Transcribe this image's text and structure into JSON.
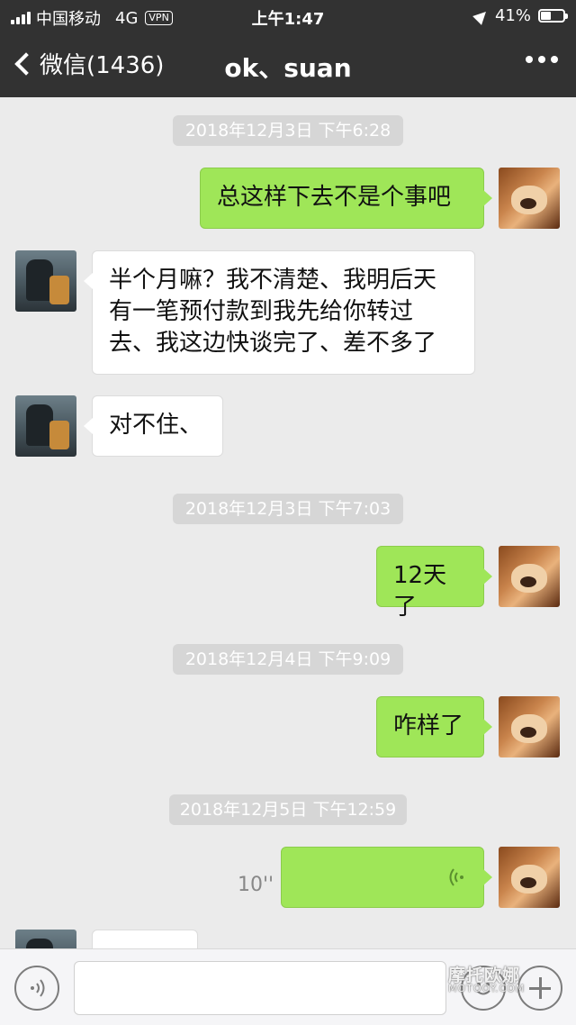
{
  "status_bar": {
    "carrier": "中国移动",
    "network": "4G",
    "vpn": "VPN",
    "time": "上午1:47",
    "battery": "41%",
    "battery_level": 0.41
  },
  "nav": {
    "back_label": "微信(1436)",
    "title": "ok、suan"
  },
  "messages": {
    "ts1": "2018年12月3日 下午6:28",
    "m1": "总这样下去不是个事吧",
    "m2": "半个月嘛？我不清楚、我明后天有一笔预付款到我先给你转过去、我这边快谈完了、差不多了",
    "m3": "对不住、",
    "ts2": "2018年12月3日 下午7:03",
    "m4": "12天了",
    "ts3": "2018年12月4日 下午9:09",
    "m5": "咋样了",
    "ts4": "2018年12月5日 下午12:59",
    "voice_duration": "10''"
  },
  "input_bar": {
    "value": ""
  },
  "watermark": {
    "main": "摩托欧娜",
    "sub": "MOTOOY.COM"
  },
  "colors": {
    "nav_bg": "#323232",
    "chat_bg": "#ebebeb",
    "my_bubble": "#9fe658",
    "other_bubble": "#ffffff",
    "timestamp_bg": "#d6d6d6"
  }
}
